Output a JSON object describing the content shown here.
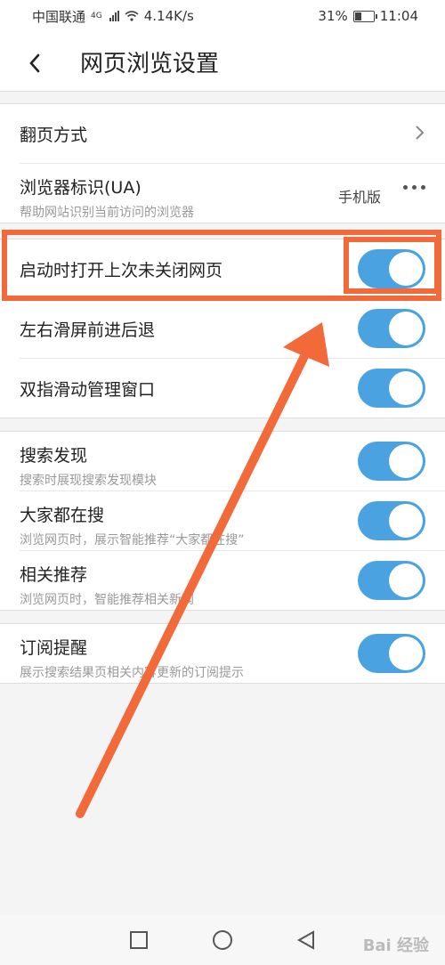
{
  "status_bar": {
    "carrier": "中国联通",
    "network": "4G",
    "speed": "4.14K/s",
    "battery": "31%",
    "battery_level": 0.31,
    "time": "11:04"
  },
  "header": {
    "title": "网页浏览设置",
    "back_icon": "chevron-left-icon"
  },
  "groups": [
    {
      "items": [
        {
          "label": "翻页方式",
          "type": "nav"
        },
        {
          "label": "浏览器标识(UA)",
          "subtitle": "帮助网站识别当前访问的浏览器",
          "value": "手机版",
          "type": "more"
        }
      ]
    },
    {
      "items": [
        {
          "label": "启动时打开上次未关闭网页",
          "type": "toggle",
          "on": true
        },
        {
          "label": "左右滑屏前进后退",
          "type": "toggle",
          "on": true
        },
        {
          "label": "双指滑动管理窗口",
          "type": "toggle",
          "on": true
        }
      ]
    },
    {
      "items": [
        {
          "label": "搜索发现",
          "subtitle": "搜索时展现搜索发现模块",
          "type": "toggle",
          "on": true
        },
        {
          "label": "大家都在搜",
          "subtitle": "浏览网页时，展示智能推荐“大家都在搜”",
          "type": "toggle",
          "on": true
        },
        {
          "label": "相关推荐",
          "subtitle": "浏览网页时，智能推荐相关新闻",
          "type": "toggle",
          "on": true
        }
      ]
    },
    {
      "items": [
        {
          "label": "订阅提醒",
          "subtitle": "展示搜索结果页相关内容更新的订阅提示",
          "type": "toggle",
          "on": true
        }
      ]
    }
  ],
  "colors": {
    "toggle_on": "#4aa2e1",
    "annotation": "#f26a3a"
  },
  "nav_bar": {
    "icons": [
      "square-icon",
      "circle-icon",
      "triangle-back-icon"
    ]
  },
  "watermark": "Bai 经验"
}
